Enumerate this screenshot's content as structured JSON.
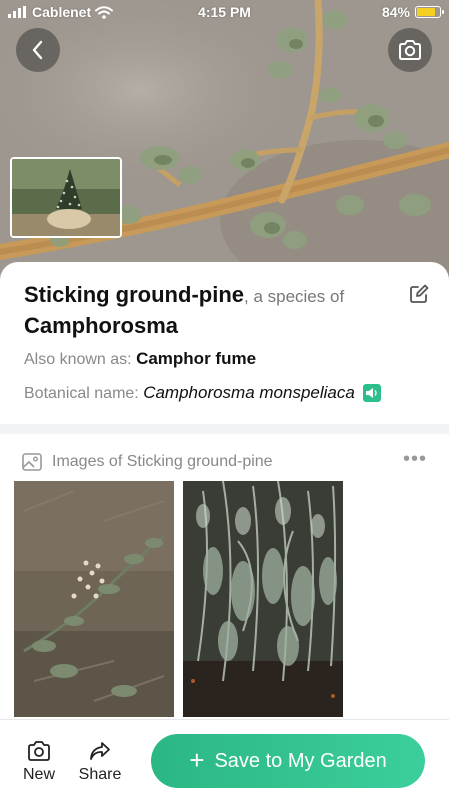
{
  "status_bar": {
    "carrier": "Cablenet",
    "time": "4:15 PM",
    "battery_percent": "84%",
    "battery_level": 0.84
  },
  "hero": {
    "back_icon": "chevron-left-icon",
    "camera_icon": "camera-icon"
  },
  "plant": {
    "common_name": "Sticking ground-pine",
    "species_of_text": ", a species of",
    "genus": "Camphorosma",
    "also_known_label": "Also known as: ",
    "also_known_value": "Camphor fume",
    "botanical_label": "Botanical name: ",
    "botanical_value": "Camphorosma monspeliaca"
  },
  "images_section": {
    "title": "Images of Sticking ground-pine",
    "more_label": "•••"
  },
  "bottom_bar": {
    "new_label": "New",
    "share_label": "Share",
    "save_label": "Save to My Garden",
    "save_plus": "+"
  },
  "colors": {
    "accent": "#2dbf8b",
    "battery": "#f5d020"
  }
}
